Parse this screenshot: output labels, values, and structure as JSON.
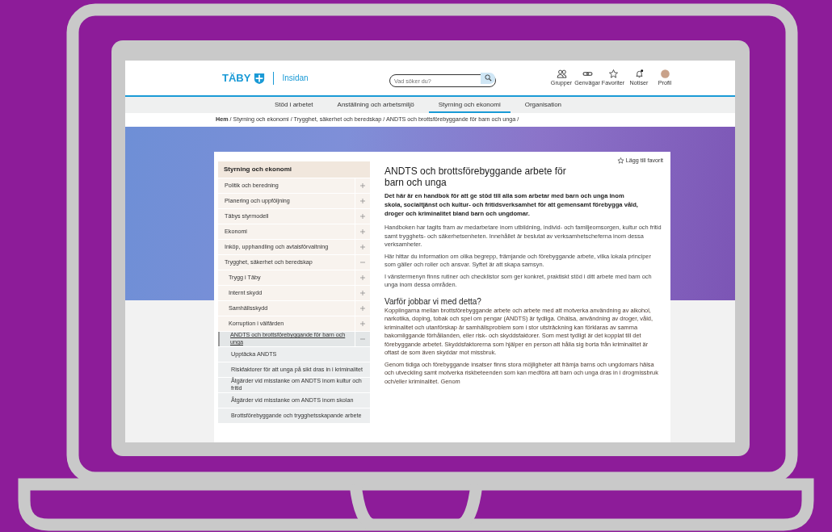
{
  "header": {
    "logo": "TÄBY",
    "site_name": "Insidan",
    "search": {
      "placeholder": "Vad söker du?"
    },
    "icons": [
      {
        "kind": "groups",
        "label": "Grupper"
      },
      {
        "kind": "link",
        "label": "Genvägar"
      },
      {
        "kind": "star",
        "label": "Favoriter"
      },
      {
        "kind": "bell",
        "label": "Notiser"
      },
      {
        "kind": "avatar",
        "label": "Profil"
      }
    ]
  },
  "nav": [
    {
      "label": "Stöd i arbetet",
      "selected": false
    },
    {
      "label": "Anställning och arbetsmiljö",
      "selected": false
    },
    {
      "label": "Styrning och ekonomi",
      "selected": true
    },
    {
      "label": "Organisation",
      "selected": false
    }
  ],
  "breadcrumb": "**Hem** / Styrning och ekonomi / Trygghet, säkerhet och beredskap / ANDTS och brottsförebyggande för barn och unga /",
  "sidebar": {
    "title": "Styrning och ekonomi",
    "items": [
      {
        "label": "Politik och beredning",
        "expanded": false,
        "selected": false
      },
      {
        "label": "Planering och uppföljning",
        "expanded": false,
        "selected": false
      },
      {
        "label": "Täbys styrmodell",
        "expanded": false,
        "selected": false
      },
      {
        "label": "Ekonomi",
        "expanded": false,
        "selected": false
      },
      {
        "label": "Inköp, upphandling och avtalsförvaltning",
        "expanded": false,
        "selected": false
      },
      {
        "label": "Trygghet, säkerhet och beredskap",
        "expanded": true,
        "selected": false,
        "children": [
          {
            "label": "Trygg i Täby",
            "expanded": false,
            "selected": false
          },
          {
            "label": "Internt skydd",
            "expanded": false,
            "selected": false
          },
          {
            "label": "Samhällsskydd",
            "expanded": false,
            "selected": false
          },
          {
            "label": "Korruption i välfärden",
            "expanded": false,
            "selected": false
          },
          {
            "label": "ANDTS och brottsförebyggande för barn och unga",
            "expanded": true,
            "selected": true,
            "children": [
              {
                "label": "Upptäcka ANDTS",
                "selected": false
              },
              {
                "label": "Riskfaktorer för att unga på sikt dras in i kriminalitet",
                "selected": false
              },
              {
                "label": "Åtgärder vid misstanke om ANDTS inom kultur och fritid",
                "selected": false
              },
              {
                "label": "Åtgärder vid misstanke om ANDTS inom skolan",
                "selected": false
              },
              {
                "label": "Brottsförebyggande och trygghetsskapande arbete",
                "selected": false
              }
            ]
          }
        ]
      }
    ]
  },
  "favorite_link": "Lägg till favorit",
  "article": {
    "title": "ANDTS och brottsförebyggande arbete för barn och unga",
    "lead": "Det här är en handbok för att ge stöd till alla som arbetar med barn och unga inom skola, socialtjänst och kultur- och fritidsverksamhet för att gemensamt förebygga våld, droger och kriminalitet bland barn och ungdomar.",
    "paragraphs": [
      "Handboken har tagits fram av medarbetare inom utbildning, individ- och familjeomsorgen, kultur och fritid samt trygghets- och säkerhetsenheten. Innehållet är beslutat av verksamhetscheferna inom dessa verksamheter.",
      "Här hittar du information om olika begrepp, främjande och förebyggande arbete, vilka lokala principer som gäller och roller och ansvar. Syftet är att skapa samsyn.",
      "I vänstermenyn finns rutiner och checklistor som ger konkret, praktiskt stöd i ditt arbete med barn och unga inom dessa områden."
    ],
    "subheading": "Varför jobbar vi med detta?",
    "section_paragraphs": [
      "Kopplingarna mellan brottsförebyggande arbete och arbete med att motverka användning av alkohol, narkotika, doping, tobak och spel om pengar (ANDTS) är tydliga. Ohälsa, användning av droger, våld, kriminalitet och utanförskap är samhällsproblem som i stor utsträckning kan förklaras av samma bakomliggande förhållanden, eller risk- och skyddsfaktorer. Som mest tydligt är det kopplat till det förebyggande arbetet. Skyddsfaktorerna som hjälper en person att hålla sig borta från kriminalitet är oftast de som även skyddar mot missbruk.",
      "Genom tidiga och förebyggande insatser finns stora möjligheter att främja barns och ungdomars hälsa och utveckling samt motverka riskbeteenden som kan medföra att barn och unga dras in i drogmissbruk och/eller kriminalitet. Genom"
    ]
  }
}
